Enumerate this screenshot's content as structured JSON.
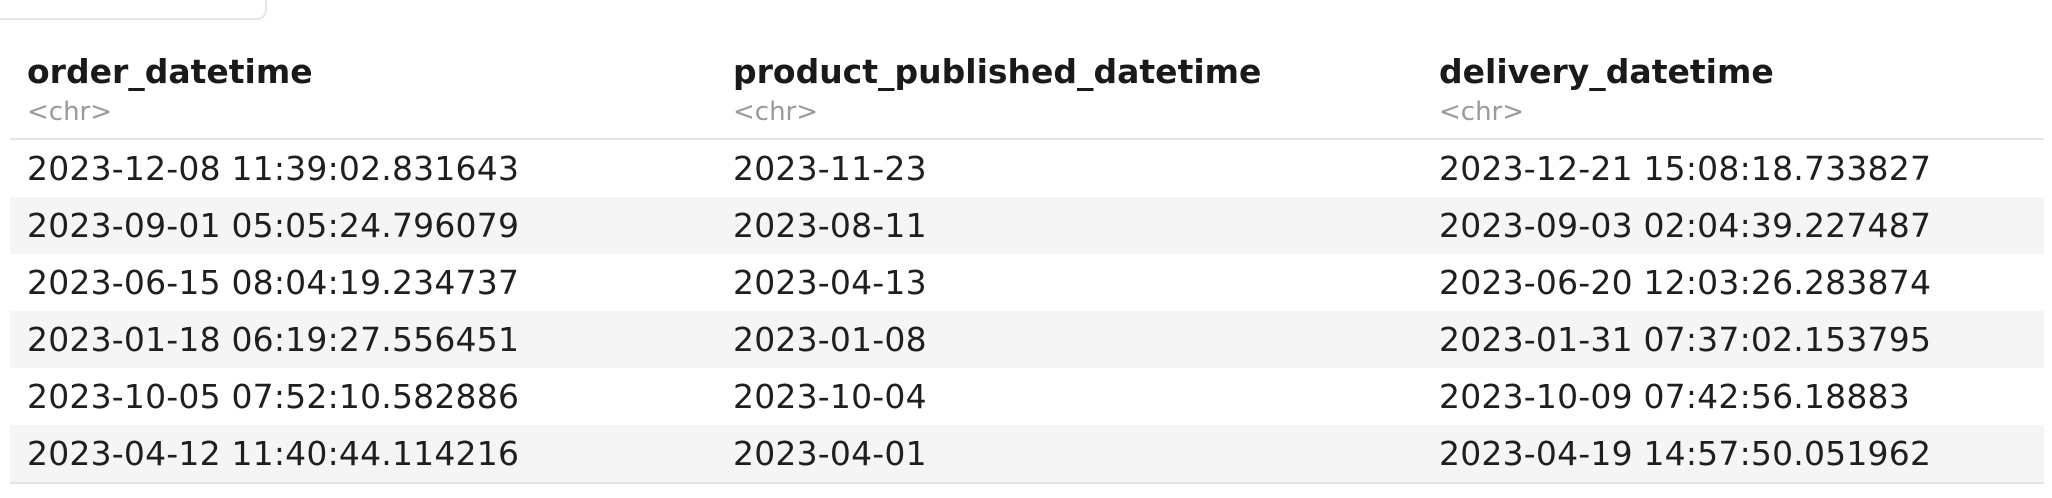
{
  "table": {
    "columns": [
      {
        "name": "order_datetime",
        "type": "<chr>"
      },
      {
        "name": "product_published_datetime",
        "type": "<chr>"
      },
      {
        "name": "delivery_datetime",
        "type": "<chr>"
      }
    ],
    "rows": [
      [
        "2023-12-08 11:39:02.831643",
        "2023-11-23",
        "2023-12-21 15:08:18.733827"
      ],
      [
        "2023-09-01 05:05:24.796079",
        "2023-08-11",
        "2023-09-03 02:04:39.227487"
      ],
      [
        "2023-06-15 08:04:19.234737",
        "2023-04-13",
        "2023-06-20 12:03:26.283874"
      ],
      [
        "2023-01-18 06:19:27.556451",
        "2023-01-08",
        "2023-01-31 07:37:02.153795"
      ],
      [
        "2023-10-05 07:52:10.582886",
        "2023-10-04",
        "2023-10-09 07:42:56.18883"
      ],
      [
        "2023-04-12 11:40:44.114216",
        "2023-04-01",
        "2023-04-19 14:57:50.051962"
      ]
    ]
  }
}
